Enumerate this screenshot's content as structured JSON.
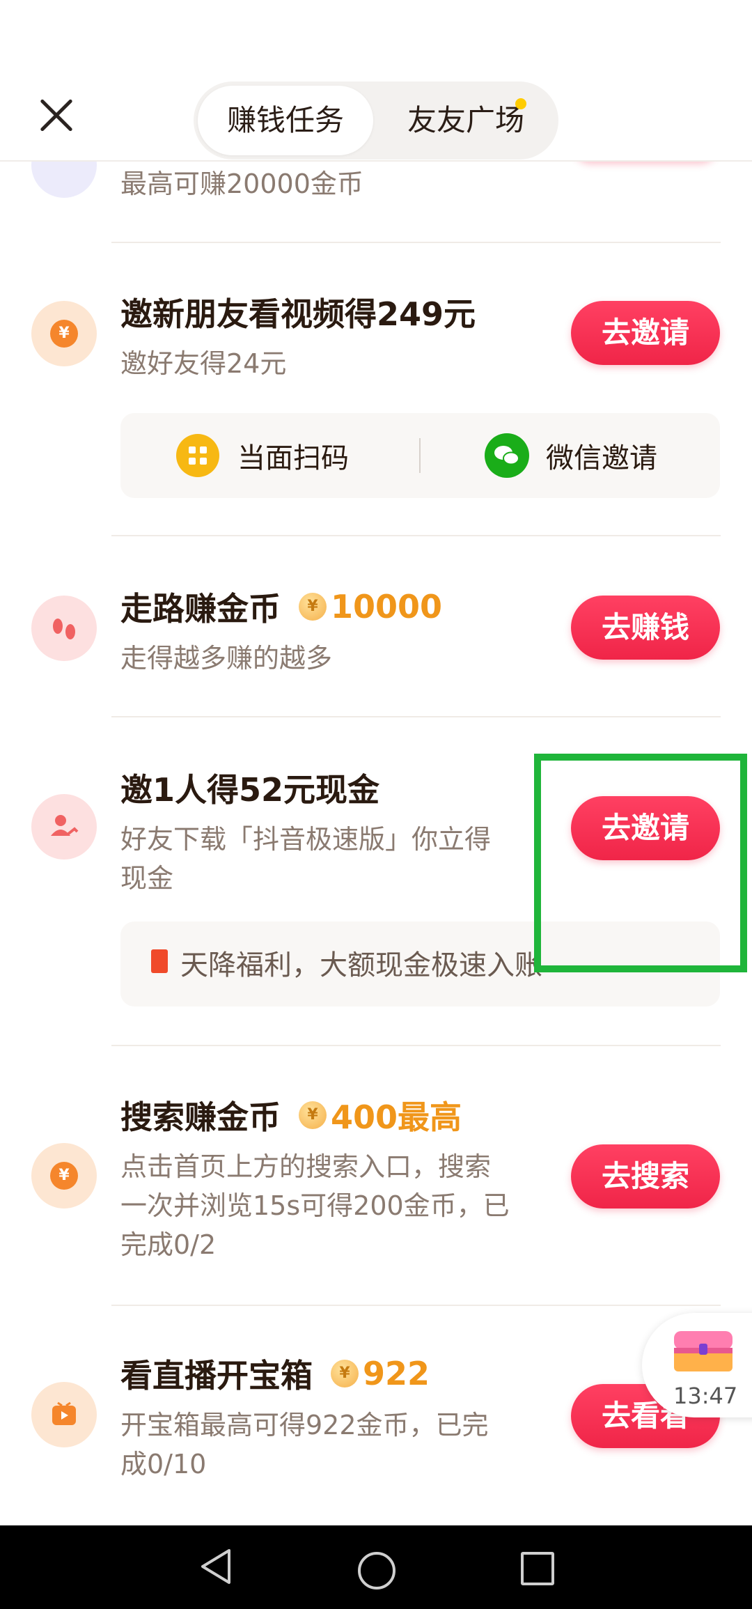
{
  "header": {
    "tabs": [
      "赚钱任务",
      "友友广场"
    ]
  },
  "items": [
    {
      "subtitle": "最高可赚20000金币"
    },
    {
      "title": "邀新朋友看视频得249元",
      "subtitle": "邀好友得24元",
      "button": "去邀请",
      "icon": "yuan-icon",
      "options": [
        "当面扫码",
        "微信邀请"
      ]
    },
    {
      "title": "走路赚金币",
      "reward": "10000",
      "subtitle": "走得越多赚的越多",
      "button": "去赚钱",
      "icon": "footprints-icon"
    },
    {
      "title": "邀1人得52元现金",
      "subtitle_line1": "好友下载「抖音极速版」你立得",
      "subtitle_line2": "现金",
      "button": "去邀请",
      "icon": "people-icon",
      "banner": "天降福利，大额现金极速入账"
    },
    {
      "title": "搜索赚金币",
      "reward": "400最高",
      "subtitle_line1": "点击首页上方的搜索入口，搜索",
      "subtitle_line2": "一次并浏览15s可得200金币，已",
      "subtitle_line3": "完成0/2",
      "button": "去搜索",
      "icon": "yuan-icon"
    },
    {
      "title": "看直播开宝箱",
      "reward": "922",
      "subtitle_line1": "开宝箱最高可得922金币，已完",
      "subtitle_line2": "成0/10",
      "button": "去看看",
      "icon": "tv-icon"
    }
  ],
  "float_box": {
    "time": "13:47"
  },
  "colors": {
    "accent": "#fe2c55",
    "reward": "#f0961a",
    "highlight": "#1fb53a"
  }
}
